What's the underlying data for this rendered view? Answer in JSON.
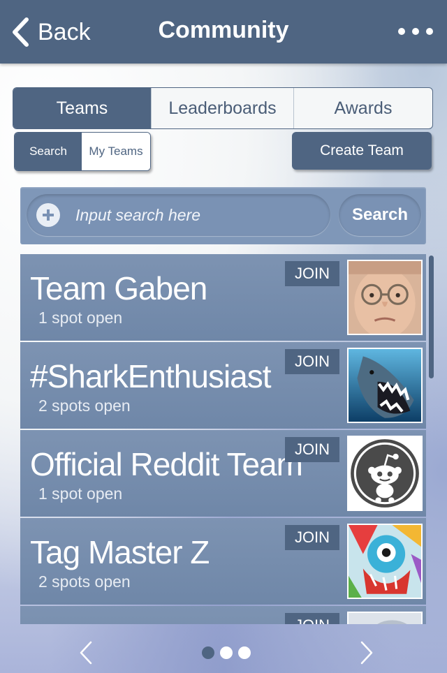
{
  "header": {
    "back_label": "Back",
    "title": "Community",
    "more_icon": "ellipsis-icon"
  },
  "tabs": [
    {
      "label": "Teams",
      "active": true
    },
    {
      "label": "Leaderboards",
      "active": false
    },
    {
      "label": "Awards",
      "active": false
    }
  ],
  "toggle": {
    "search_label": "Search",
    "myteams_label": "My Teams",
    "active": "Search"
  },
  "create_team_label": "Create Team",
  "search": {
    "placeholder": "Input search here",
    "value": "",
    "button_label": "Search"
  },
  "teams": [
    {
      "name": "Team Gaben",
      "spots": "1 spot open",
      "join_label": "JOIN",
      "avatar": "bald-man-portrait"
    },
    {
      "name": "#SharkEnthusiast",
      "spots": "2 spots open",
      "join_label": "JOIN",
      "avatar": "shark-photo"
    },
    {
      "name": "Official Reddit Team",
      "spots": "1 spot open",
      "join_label": "JOIN",
      "avatar": "reddit-alien-logo"
    },
    {
      "name": "Tag Master Z",
      "spots": "2 spots open",
      "join_label": "JOIN",
      "avatar": "graffiti-art"
    },
    {
      "name": "",
      "spots": "",
      "join_label": "JOIN",
      "avatar": "partial-thumbnail"
    }
  ],
  "pager": {
    "page_count": 3,
    "current_page": 1
  },
  "colors": {
    "primary": "#4f6582",
    "row": "#7890b0",
    "searchbar": "#7f97b8"
  }
}
